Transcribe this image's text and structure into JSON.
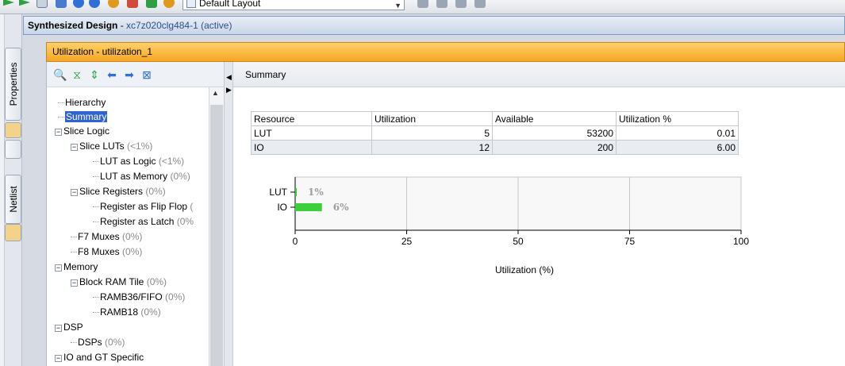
{
  "toolbar": {
    "layout_select": "Default Layout",
    "colors": {
      "green": "#2ea043",
      "blue": "#2f6fd6",
      "orange": "#e09a1b"
    }
  },
  "rail": {
    "properties_tab": "Properties",
    "netlist_tab": "Netlist"
  },
  "design_header": {
    "title": "Synthesized Design",
    "separator": " - ",
    "part": "xc7z020clg484-1",
    "status": "(active)"
  },
  "util_panel": {
    "title": "Utilization - utilization_1"
  },
  "tree": {
    "items": [
      {
        "label": "Hierarchy",
        "pct": "",
        "expander": "",
        "selected": false
      },
      {
        "label": "Summary",
        "pct": "",
        "expander": "",
        "selected": true
      },
      {
        "label": "Slice Logic",
        "pct": "",
        "expander": "−",
        "selected": false
      },
      {
        "label": "Slice LUTs",
        "pct": "(<1%)",
        "expander": "−",
        "selected": false
      },
      {
        "label": "LUT as Logic",
        "pct": "(<1%)",
        "expander": "",
        "selected": false
      },
      {
        "label": "LUT as Memory",
        "pct": "(0%)",
        "expander": "",
        "selected": false
      },
      {
        "label": "Slice Registers",
        "pct": "(0%)",
        "expander": "−",
        "selected": false
      },
      {
        "label": "Register as Flip Flop",
        "pct": "(",
        "expander": "",
        "selected": false
      },
      {
        "label": "Register as Latch",
        "pct": "(0%",
        "expander": "",
        "selected": false
      },
      {
        "label": "F7 Muxes",
        "pct": "(0%)",
        "expander": "",
        "selected": false
      },
      {
        "label": "F8 Muxes",
        "pct": "(0%)",
        "expander": "",
        "selected": false
      },
      {
        "label": "Memory",
        "pct": "",
        "expander": "−",
        "selected": false
      },
      {
        "label": "Block RAM Tile",
        "pct": "(0%)",
        "expander": "−",
        "selected": false
      },
      {
        "label": "RAMB36/FIFO",
        "pct": "(0%)",
        "expander": "",
        "selected": false
      },
      {
        "label": "RAMB18",
        "pct": "(0%)",
        "expander": "",
        "selected": false
      },
      {
        "label": "DSP",
        "pct": "",
        "expander": "−",
        "selected": false
      },
      {
        "label": "DSPs",
        "pct": "(0%)",
        "expander": "",
        "selected": false
      },
      {
        "label": "IO and GT Specific",
        "pct": "",
        "expander": "−",
        "selected": false
      }
    ]
  },
  "summary": {
    "tab_label": "Summary",
    "table": {
      "headers": [
        "Resource",
        "Utilization",
        "Available",
        "Utilization %"
      ],
      "rows": [
        [
          "LUT",
          "5",
          "53200",
          "0.01"
        ],
        [
          "IO",
          "12",
          "200",
          "6.00"
        ]
      ]
    }
  },
  "chart_data": {
    "type": "bar",
    "orientation": "horizontal",
    "categories": [
      "LUT",
      "IO"
    ],
    "values": [
      0.01,
      6.0
    ],
    "data_labels": [
      "1%",
      "6%"
    ],
    "xlabel": "Utilization (%)",
    "xlim": [
      0,
      100
    ],
    "ticks": [
      "0",
      "25",
      "50",
      "75",
      "100"
    ],
    "tick_values": [
      0,
      25,
      50,
      75,
      100
    ],
    "grid": true,
    "bar_color": "#3ccf3c",
    "label_color": "#9e9e9e"
  }
}
